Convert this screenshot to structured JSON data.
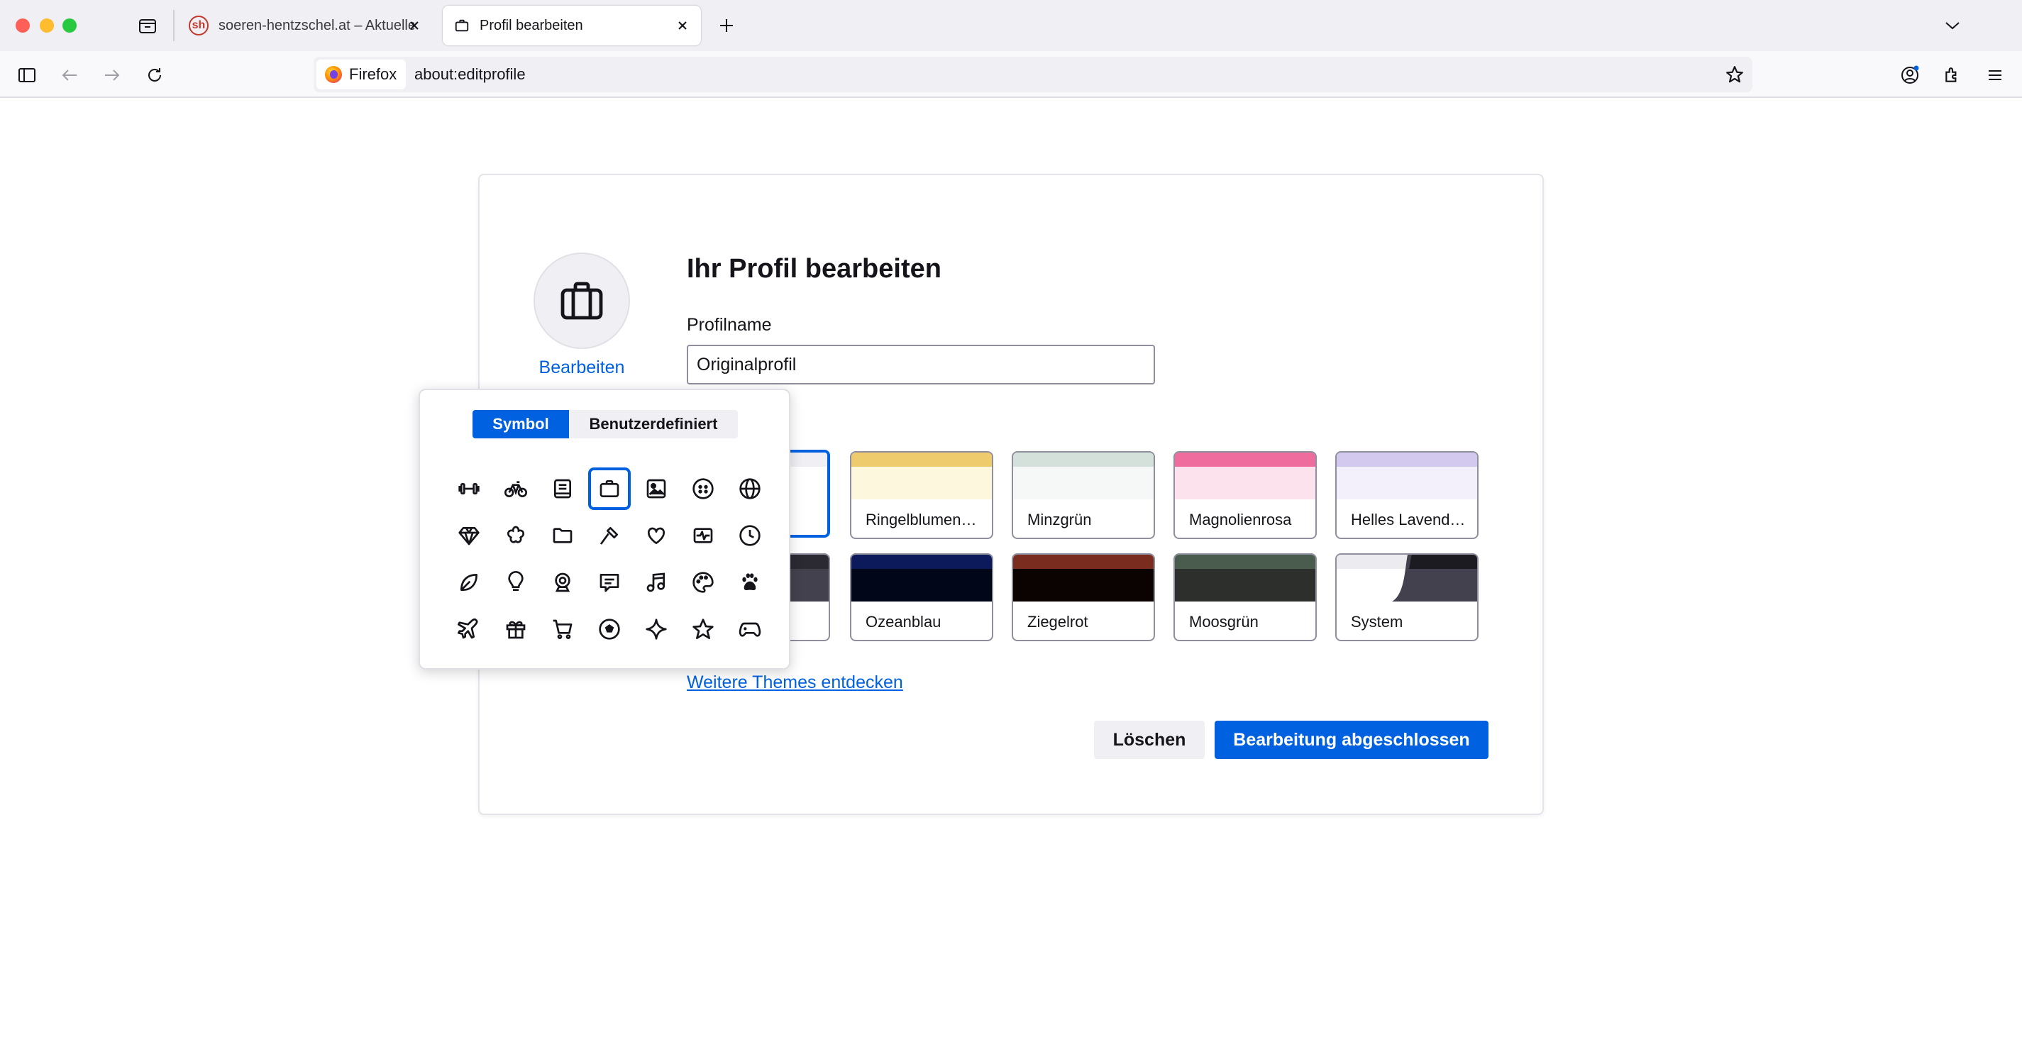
{
  "browser": {
    "tabs": [
      {
        "favicon": "sh",
        "title": "soeren-hentzschel.at – Aktuelle"
      },
      {
        "title": "Profil bearbeiten"
      }
    ],
    "identity_label": "Firefox",
    "url": "about:editprofile"
  },
  "page": {
    "heading": "Ihr Profil bearbeiten",
    "name_label": "Profilname",
    "name_value": "Originalprofil",
    "avatar_edit": "Bearbeiten",
    "themes": [
      {
        "label": "",
        "selected": true
      },
      {
        "label": "Ringelblumen…",
        "top": "#eecb6c",
        "mid": "#fdf7de"
      },
      {
        "label": "Minzgrün",
        "top": "#d4e1da",
        "mid": "#f5f8f6"
      },
      {
        "label": "Magnolienrosa",
        "top": "#ee6c9e",
        "mid": "#fbe2ec"
      },
      {
        "label": "Helles Lavend…",
        "top": "#d3c9ee",
        "mid": "#f3f0fc"
      },
      {
        "label": "",
        "top": "#2b2a33",
        "mid": "#42414d"
      },
      {
        "label": "Ozeanblau",
        "top": "#0c1a5c",
        "mid": "#010718"
      },
      {
        "label": "Ziegelrot",
        "top": "#7a2d1e",
        "mid": "#0a0302"
      },
      {
        "label": "Moosgrün",
        "top": "#4a5c4d",
        "mid": "#2d2f2d"
      },
      {
        "label": "System",
        "top": "#ececf0",
        "mid": "#ffffff"
      }
    ],
    "more_themes": "Weitere Themes entdecken",
    "delete_button": "Löschen",
    "done_button": "Bearbeitung abgeschlossen"
  },
  "picker": {
    "tabs": [
      "Symbol",
      "Benutzerdefiniert"
    ],
    "active_tab": "Symbol",
    "icons": [
      "dumbbell-icon",
      "bicycle-icon",
      "book-icon",
      "briefcase-icon",
      "picture-icon",
      "smiley-icon",
      "globe-icon",
      "diamond-icon",
      "flower-icon",
      "folder-icon",
      "hammer-icon",
      "heart-icon",
      "heartbeat-icon",
      "clock-icon",
      "leaf-icon",
      "lightbulb-icon",
      "webcam-icon",
      "speech-bubble-icon",
      "music-note-icon",
      "palette-icon",
      "paw-icon",
      "airplane-icon",
      "gift-icon",
      "shopping-cart-icon",
      "soccer-ball-icon",
      "sparkle-icon",
      "star-icon",
      "gamepad-icon"
    ],
    "selected_icon": "briefcase-icon"
  },
  "colors": {
    "accent": "#0061e0",
    "chrome_bg": "#f0f0f4"
  }
}
